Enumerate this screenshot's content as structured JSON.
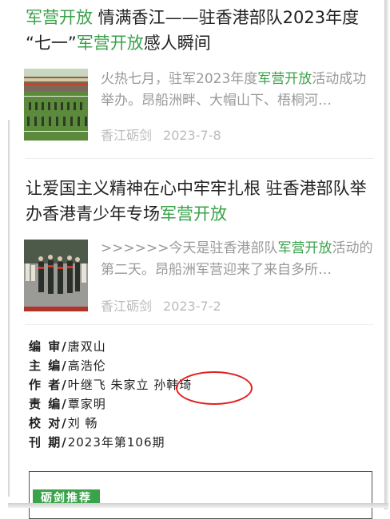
{
  "articles": [
    {
      "title_parts": [
        "军营开放",
        " 情满香江——驻香港部队2023年度",
        "“七一”",
        "军营开放",
        "感人瞬间"
      ],
      "summary_parts": [
        "火热七月，驻军2023年度",
        "军营开放",
        "活动成功举办。昂船洲畔、大帽山下、梧桐河…"
      ],
      "source": "香江砺剑",
      "date": "2023-7-8"
    },
    {
      "title_parts": [
        "让爱国主义精神在心中牢牢扎根 驻香港部队举办香港青少年专场",
        "军营开放"
      ],
      "summary_parts": [
        ">>>>>>今天是驻香港部队",
        "军营开放",
        "活动的第二天。昂船洲军营迎来了来自多所…"
      ],
      "source": "香江砺剑",
      "date": "2023-7-2"
    }
  ],
  "credits": [
    {
      "label": "编 审/",
      "value": "唐双山"
    },
    {
      "label": "主 编/",
      "value": "高浩伦"
    },
    {
      "label": "作 者/",
      "value": "叶继飞 朱家立 孙韩琦"
    },
    {
      "label": "责 编/",
      "value": "覃家明"
    },
    {
      "label": "校 对/",
      "value": "刘   畅"
    },
    {
      "label": "刊 期/",
      "value": "2023年第106期"
    }
  ],
  "recommend": {
    "label": "砺剑推荐"
  },
  "colors": {
    "accent": "#3aa24a",
    "annotation": "#e02020"
  }
}
